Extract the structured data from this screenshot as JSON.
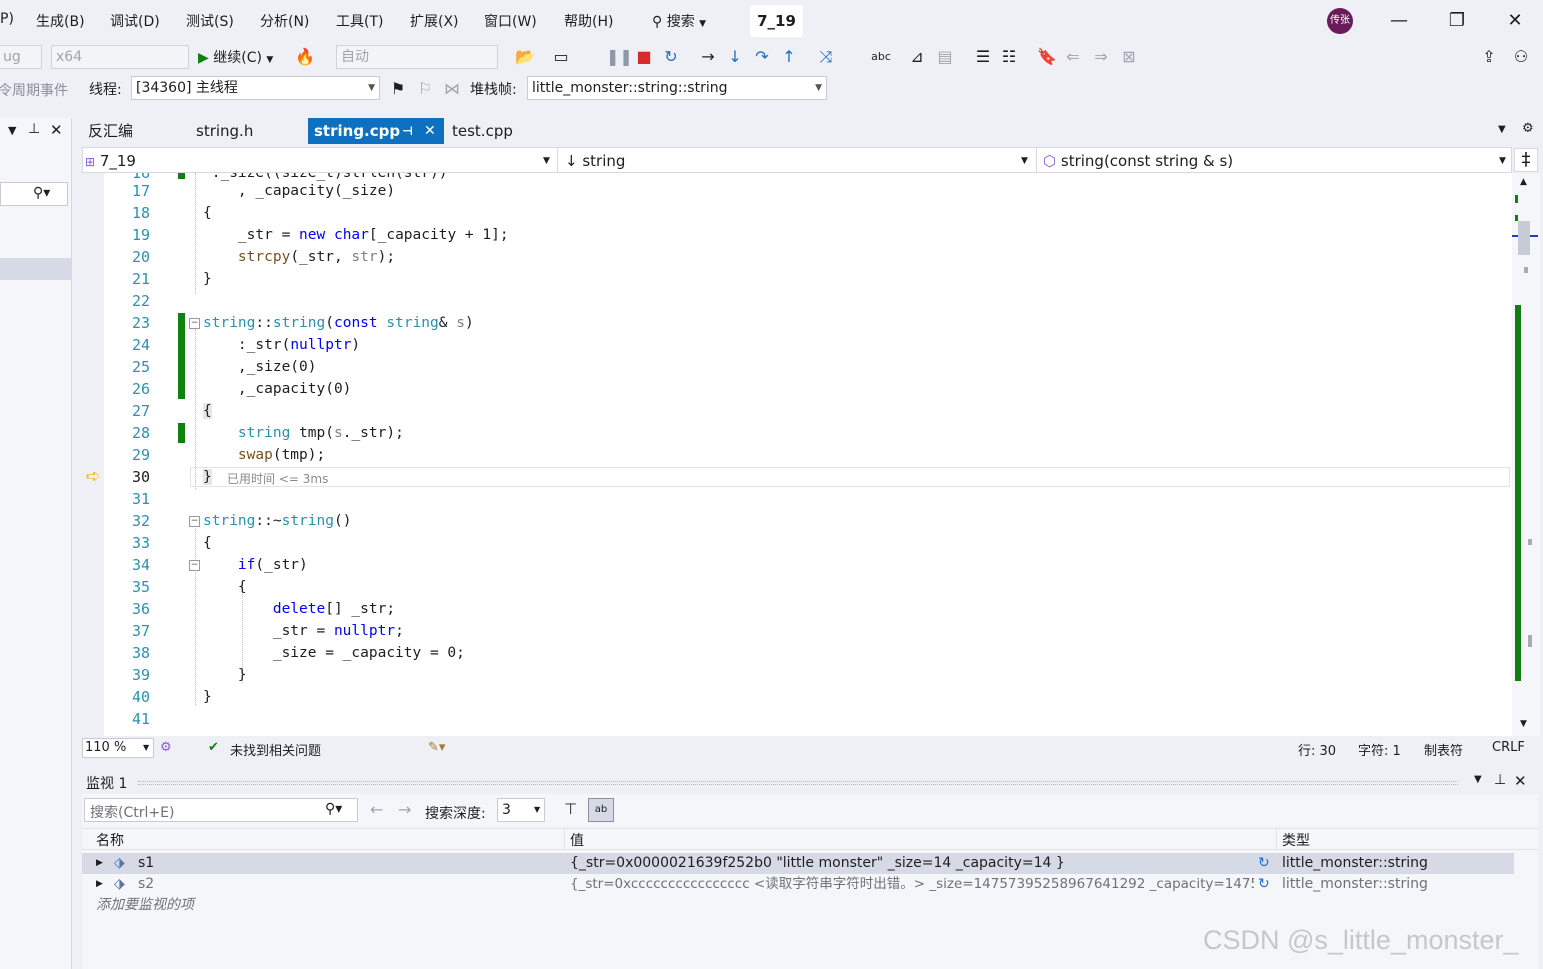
{
  "menu": {
    "items": [
      "P)",
      "生成(B)",
      "调试(D)",
      "测试(S)",
      "分析(N)",
      "工具(T)",
      "扩展(X)",
      "窗口(W)",
      "帮助(H)"
    ],
    "search": "搜索",
    "solution_title": "7_19",
    "avatar": "传张"
  },
  "toolbar": {
    "config": "ug",
    "platform": "x64",
    "continue_label": "继续(C)",
    "auto_label": "自动"
  },
  "debugbar": {
    "lifecycle_label": "令周期事件",
    "thread_label": "线程:",
    "thread_value": "[34360] 主线程",
    "stackframe_label": "堆栈帧:",
    "stackframe_value": "little_monster::string::string"
  },
  "tabs": [
    {
      "label": "反汇编",
      "active": false
    },
    {
      "label": "string.h",
      "active": false
    },
    {
      "label": "string.cpp",
      "active": true
    },
    {
      "label": "test.cpp",
      "active": false
    }
  ],
  "navbar": {
    "project": "7_19",
    "scope": "string",
    "member": "string(const string & s)"
  },
  "editor": {
    "current_line": 30,
    "perf_tip": "已用时间 <= 3ms"
  },
  "status": {
    "zoom": "110 %",
    "issues": "未找到相关问题",
    "line": "行: 30",
    "char": "字符: 1",
    "tabs": "制表符",
    "eol": "CRLF"
  },
  "watch": {
    "title": "监视 1",
    "search_placeholder": "搜索(Ctrl+E)",
    "depth_label": "搜索深度:",
    "depth_value": "3",
    "col_name": "名称",
    "col_value": "值",
    "col_type": "类型",
    "rows": [
      {
        "name": "s1",
        "value": "{_str=0x0000021639f252b0 \"little monster\" _size=14 _capacity=14 }",
        "type": "little_monster::string"
      },
      {
        "name": "s2",
        "value": "{_str=0xcccccccccccccccc <读取字符串字符时出错。> _size=14757395258967641292 _capacity=1475...",
        "type": "little_monster::string"
      }
    ],
    "add_item": "添加要监视的项"
  },
  "watermark": "CSDN @s_little_monster_",
  "colors": {
    "accent": "#0e70c0",
    "change_bar": "#108010",
    "keyword": "#0000ff",
    "type": "#2b91af",
    "function": "#74531f"
  }
}
